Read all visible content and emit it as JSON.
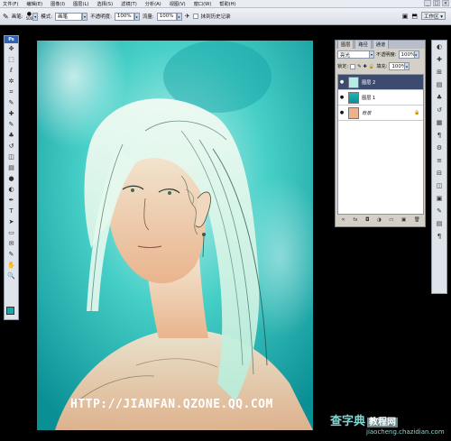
{
  "menu": {
    "items": [
      "文件(F)",
      "编辑(E)",
      "图像(I)",
      "图层(L)",
      "选择(S)",
      "滤镜(T)",
      "分析(A)",
      "视图(V)",
      "窗口(W)",
      "帮助(H)"
    ],
    "win_buttons": [
      "_",
      "□",
      "×"
    ]
  },
  "options": {
    "brush_label": "画笔:",
    "brush_size": "500",
    "mode_label": "模式:",
    "mode_value": "画笔",
    "opacity_label": "不透明度:",
    "opacity_value": "100%",
    "flow_label": "流量:",
    "flow_value": "100%",
    "history_label": "抹到历史记录",
    "workspace_label": "工作区 ▾"
  },
  "toolbox": {
    "logo": "Ps",
    "tools": [
      "move-tool-icon",
      "marquee-tool-icon",
      "lasso-tool-icon",
      "magic-wand-icon",
      "crop-tool-icon",
      "eyedropper-icon",
      "healing-brush-icon",
      "brush-tool-icon",
      "clone-stamp-icon",
      "history-brush-icon",
      "eraser-icon",
      "gradient-icon",
      "blur-icon",
      "dodge-icon",
      "pen-icon",
      "type-tool-icon",
      "path-select-icon",
      "shape-icon",
      "notes-icon",
      "eyedropper2-icon",
      "hand-icon",
      "zoom-icon"
    ],
    "glyphs": [
      "✥",
      "⬚",
      "ℓ",
      "✲",
      "⌗",
      "✎",
      "✚",
      "✎",
      "♣",
      "↺",
      "◫",
      "▤",
      "●",
      "◐",
      "✒",
      "T",
      "➤",
      "▭",
      "✉",
      "✎",
      "✋",
      "🔍"
    ],
    "fg_color": "#1aa6a9",
    "bg_color": "#ffffff"
  },
  "layers_panel": {
    "tabs": [
      "图层",
      "路径",
      "通道"
    ],
    "blend_mode": "亮光",
    "opacity_label": "不透明度:",
    "opacity_value": "100%",
    "lock_label": "锁定:",
    "fill_label": "填充:",
    "fill_value": "100%",
    "layers": [
      {
        "name": "图层 2",
        "selected": true
      },
      {
        "name": "图层 1",
        "selected": false
      },
      {
        "name": "背景",
        "selected": false
      }
    ],
    "bottom_icons": [
      "∞",
      "fx",
      "◘",
      "◑",
      "▭",
      "▣",
      "🗑"
    ]
  },
  "right_strip_glyphs": [
    "◐",
    "✚",
    "⊞",
    "▤",
    "♣",
    "↺",
    "▦",
    "¶",
    "⚙",
    "≡",
    "⊟",
    "◫",
    "▣",
    "✎",
    "▤",
    "¶"
  ],
  "watermark": {
    "url": "HTTP://JIANFAN.QZONE.QQ.COM",
    "site_cn": "查字典",
    "site_tag": "教程网",
    "site_url": "jiaocheng.chazidian.com"
  }
}
